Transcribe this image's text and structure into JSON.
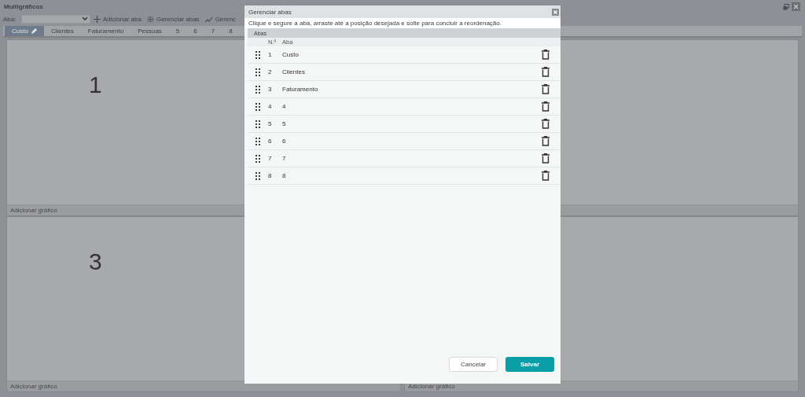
{
  "window": {
    "title": "Multigráficos"
  },
  "toolbar": {
    "tab_label": "Aba:",
    "add_button": "Adicionar aba",
    "manage_button": "Gerenciar abas",
    "third_button": "Gerenc"
  },
  "tabs": [
    {
      "label": "Custo",
      "selected": true
    },
    {
      "label": "Clientes",
      "selected": false
    },
    {
      "label": "Faturamento",
      "selected": false
    },
    {
      "label": "Pessoas",
      "selected": false
    },
    {
      "label": "5",
      "selected": false
    },
    {
      "label": "6",
      "selected": false
    },
    {
      "label": "7",
      "selected": false
    },
    {
      "label": "8",
      "selected": false
    }
  ],
  "panels": [
    {
      "number": "1",
      "footer": "Adicionar gráfico"
    },
    {
      "number": "3",
      "footer": "Adicionar gráfico"
    },
    {
      "footer": "Adicionar gráfico"
    }
  ],
  "dialog": {
    "title": "Gerenciar abas",
    "instruction": "Clique e segure a aba, arraste até a posição desejada e solte para concluir a reordenação.",
    "section": "Abas",
    "columns": [
      "N.º",
      "Aba"
    ],
    "rows": [
      {
        "number": "1",
        "name": "Custo"
      },
      {
        "number": "2",
        "name": "Clientes"
      },
      {
        "number": "3",
        "name": "Faturamento"
      },
      {
        "number": "4",
        "name": "4"
      },
      {
        "number": "5",
        "name": "5"
      },
      {
        "number": "6",
        "name": "6"
      },
      {
        "number": "7",
        "name": "7"
      },
      {
        "number": "8",
        "name": "8"
      }
    ],
    "cancel": "Cancelar",
    "save": "Salvar"
  }
}
